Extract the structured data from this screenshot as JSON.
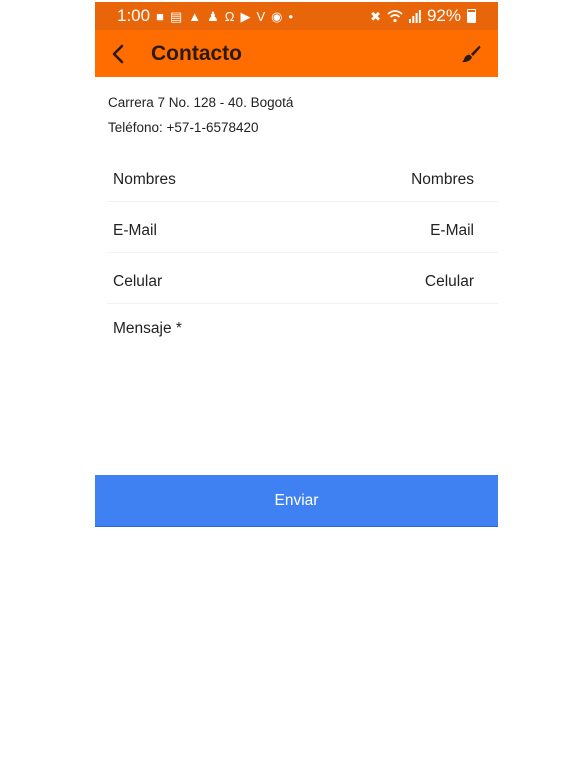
{
  "status_bar": {
    "time": "1:00",
    "battery": "92%",
    "icons_left": [
      "chat-icon",
      "news-icon",
      "landscape-icon",
      "walking-icon",
      "headphones-icon",
      "youtube-icon",
      "vimeo-icon",
      "teams-icon",
      "dot-icon"
    ],
    "icons_right": [
      "mute-icon",
      "wifi-icon",
      "signal-icon",
      "battery-icon"
    ]
  },
  "app_bar": {
    "title": "Contacto",
    "back_icon": "back-arrow-icon",
    "action_icon": "paint-brush-icon"
  },
  "contact_info": {
    "address": "Carrera 7 No. 128 - 40. Bogotá",
    "phone": "Teléfono: +57-1-6578420"
  },
  "form": {
    "name": {
      "label": "Nombres",
      "placeholder": "Nombres",
      "value": ""
    },
    "email": {
      "label": "E-Mail",
      "placeholder": "E-Mail",
      "value": ""
    },
    "mobile": {
      "label": "Celular",
      "placeholder": "Celular",
      "value": ""
    },
    "message": {
      "label": "Mensaje *",
      "value": ""
    },
    "submit_label": "Enviar"
  },
  "colors": {
    "status_bar": "#e8650a",
    "app_bar": "#ff6d00",
    "button": "#3f80f3"
  }
}
